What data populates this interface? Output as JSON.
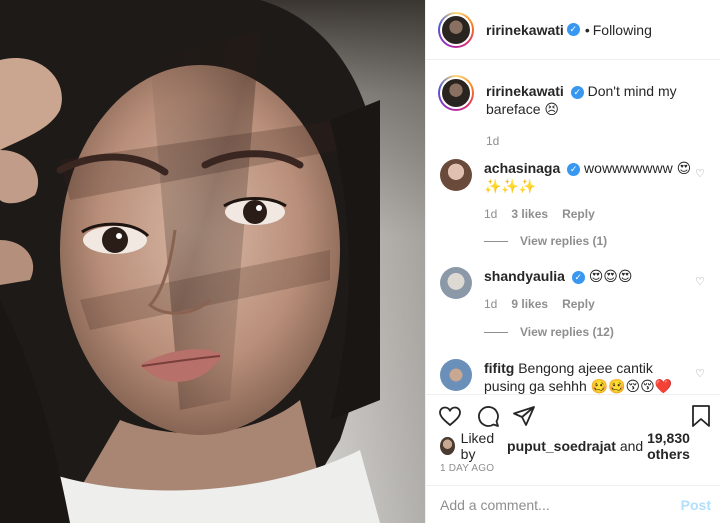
{
  "post": {
    "author": "ririnekawati",
    "follow_dot": "•",
    "follow_status": "Following",
    "verified_glyph": "✓"
  },
  "caption": {
    "author": "ririnekawati",
    "text": "Don't mind my bareface",
    "emoji": "😣",
    "age": "1d"
  },
  "comments": [
    {
      "author": "achasinaga",
      "text": "wowwwwwww",
      "emoji": "😍",
      "line2": "✨✨✨",
      "age": "1d",
      "likes": "3 likes",
      "reply": "Reply",
      "view_replies": "View replies (1)",
      "avatar_color": "#b08a78"
    },
    {
      "author": "shandyaulia",
      "text": "",
      "emoji": "😍😍😍",
      "age": "1d",
      "likes": "9 likes",
      "reply": "Reply",
      "view_replies": "View replies (12)",
      "avatar_color": "#9aa6b2"
    },
    {
      "author": "fifitg",
      "text": "Bengong ajeee cantik",
      "line2": "pusing ga sehhh",
      "emoji": "🥴🥴😚😚❤️",
      "avatar_color": "#7fa8c8"
    }
  ],
  "likes": {
    "prefix": "Liked by",
    "user": "puput_soedrajat",
    "and": "and",
    "count": "19,830 others"
  },
  "time_ago": "1 DAY AGO",
  "comment_box": {
    "placeholder": "Add a comment...",
    "post_label": "Post"
  },
  "icons": {
    "like": "heart-icon",
    "comment": "comment-icon",
    "share": "share-icon",
    "save": "bookmark-icon"
  }
}
